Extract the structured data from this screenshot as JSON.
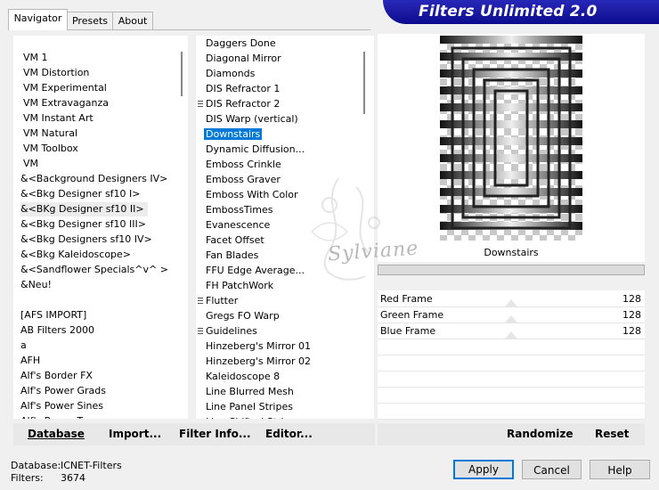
{
  "tabs": [
    "Navigator",
    "Presets",
    "About"
  ],
  "banner_title": "Filters Unlimited 2.0",
  "categories": [
    "VM 1",
    "VM Distortion",
    "VM Experimental",
    "VM Extravaganza",
    "VM Instant Art",
    "VM Natural",
    "VM Toolbox",
    "VM",
    "&<Background Designers IV>",
    "&<Bkg Designer sf10 I>",
    "&<BKg Designer sf10 II>",
    "&<Bkg Designer sf10 III>",
    "&<Bkg Designers sf10 IV>",
    "&<Bkg Kaleidoscope>",
    "&<Sandflower Specials^v^ >",
    "&Neu!",
    "",
    "[AFS IMPORT]",
    "AB Filters 2000",
    "a",
    "AFH",
    "Alf's Border FX",
    "Alf's Power Grads",
    "Alf's Power Sines",
    "Alf's Power Toys"
  ],
  "selected_category": "&<BKg Designer sf10 II>",
  "filters": [
    "Daggers Done",
    "Diagonal Mirror",
    "Diamonds",
    "DIS Refractor 1",
    "DIS Refractor 2",
    "DIS Warp (vertical)",
    "Downstairs",
    "Dynamic Diffusion...",
    "Emboss Crinkle",
    "Emboss Graver",
    "Emboss With Color",
    "EmbossTimes",
    "Evanescence",
    "Facet Offset",
    "Fan Blades",
    "FFU Edge Average...",
    "FH PatchWork",
    "Flutter",
    "Gregs FO Warp",
    "Guidelines",
    "Hinzeberg's Mirror 01",
    "Hinzeberg's Mirror 02",
    "Kaleidoscope 8",
    "Line Blurred Mesh",
    "Line Panel Stripes",
    "Line Shifted Stripes"
  ],
  "selected_filter": "Downstairs",
  "filters_with_grip": [
    "DIS Refractor 2",
    "Flutter",
    "Guidelines"
  ],
  "preview_name": "Downstairs",
  "params": [
    {
      "label": "Red Frame",
      "value": "128"
    },
    {
      "label": "Green Frame",
      "value": "128"
    },
    {
      "label": "Blue Frame",
      "value": "128"
    }
  ],
  "left_buttons": {
    "database": "Database",
    "import": "Import...",
    "filter_info": "Filter Info...",
    "editor": "Editor..."
  },
  "right_buttons": {
    "randomize": "Randomize",
    "reset": "Reset"
  },
  "footer": {
    "database_label": "Database:",
    "database_value": "ICNET-Filters",
    "filters_label": "Filters:",
    "filters_value": "3674"
  },
  "dialog_buttons": {
    "apply": "Apply",
    "cancel": "Cancel",
    "help": "Help"
  },
  "watermark_text": "Sylviane",
  "colors": {
    "banner": "#1a1aa6",
    "selection": "#0078d7",
    "default_button_border": "#0078d7"
  }
}
